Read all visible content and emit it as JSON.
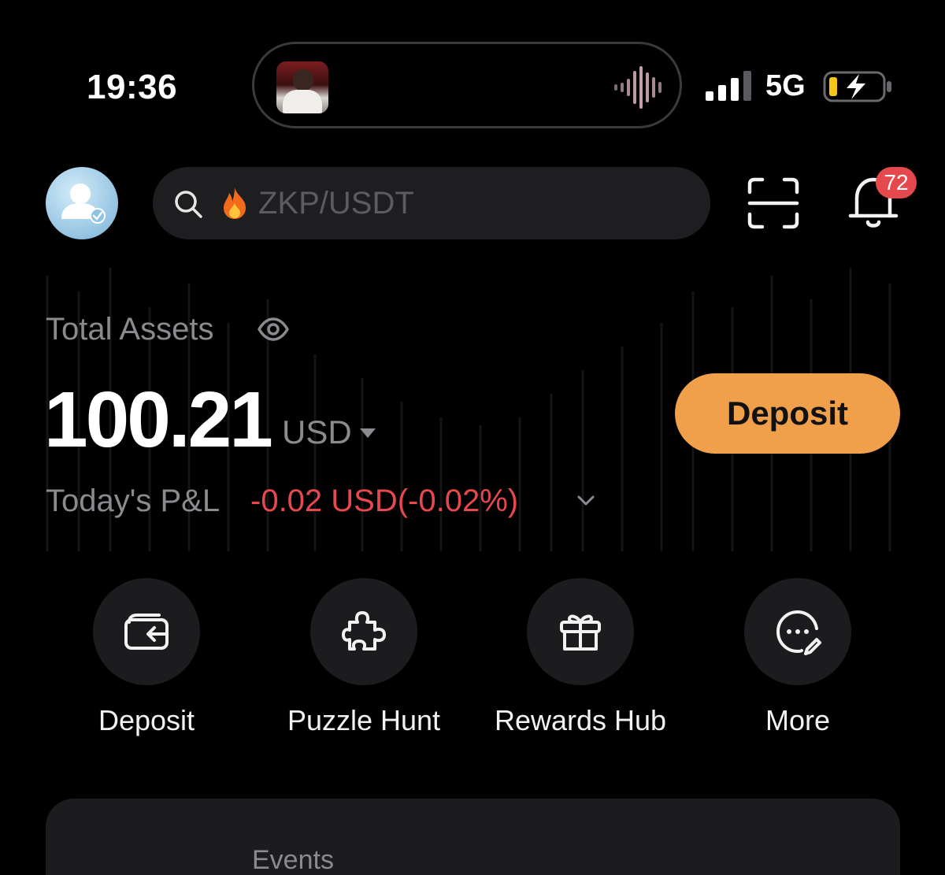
{
  "status_bar": {
    "time": "19:36",
    "network": "5G",
    "now_playing": {
      "album_art": "album-art-thumbnail",
      "indicator": "audio-waveform-icon"
    }
  },
  "header": {
    "avatar_icon": "user-verified-icon",
    "search": {
      "placeholder": "ZKP/USDT",
      "hot_icon": "fire-icon"
    },
    "scan_icon": "scan-icon",
    "notifications": {
      "icon": "bell-icon",
      "badge_count": "72"
    }
  },
  "assets": {
    "label": "Total Assets",
    "balance": "100.21",
    "currency": "USD",
    "deposit_button": "Deposit",
    "pnl_label": "Today's P&L",
    "pnl_value": "-0.02 USD(-0.02%)"
  },
  "quick_actions": [
    {
      "label": "Deposit",
      "icon": "wallet-deposit-icon"
    },
    {
      "label": "Puzzle Hunt",
      "icon": "puzzle-piece-icon"
    },
    {
      "label": "Rewards Hub",
      "icon": "gift-icon"
    },
    {
      "label": "More",
      "icon": "more-edit-icon"
    }
  ],
  "events": {
    "tab_label": "Events"
  },
  "colors": {
    "background": "#000000",
    "accent": "#f0a04b",
    "negative": "#e5484d",
    "muted_text": "#8a8a8f",
    "surface": "#1c1c1e"
  }
}
